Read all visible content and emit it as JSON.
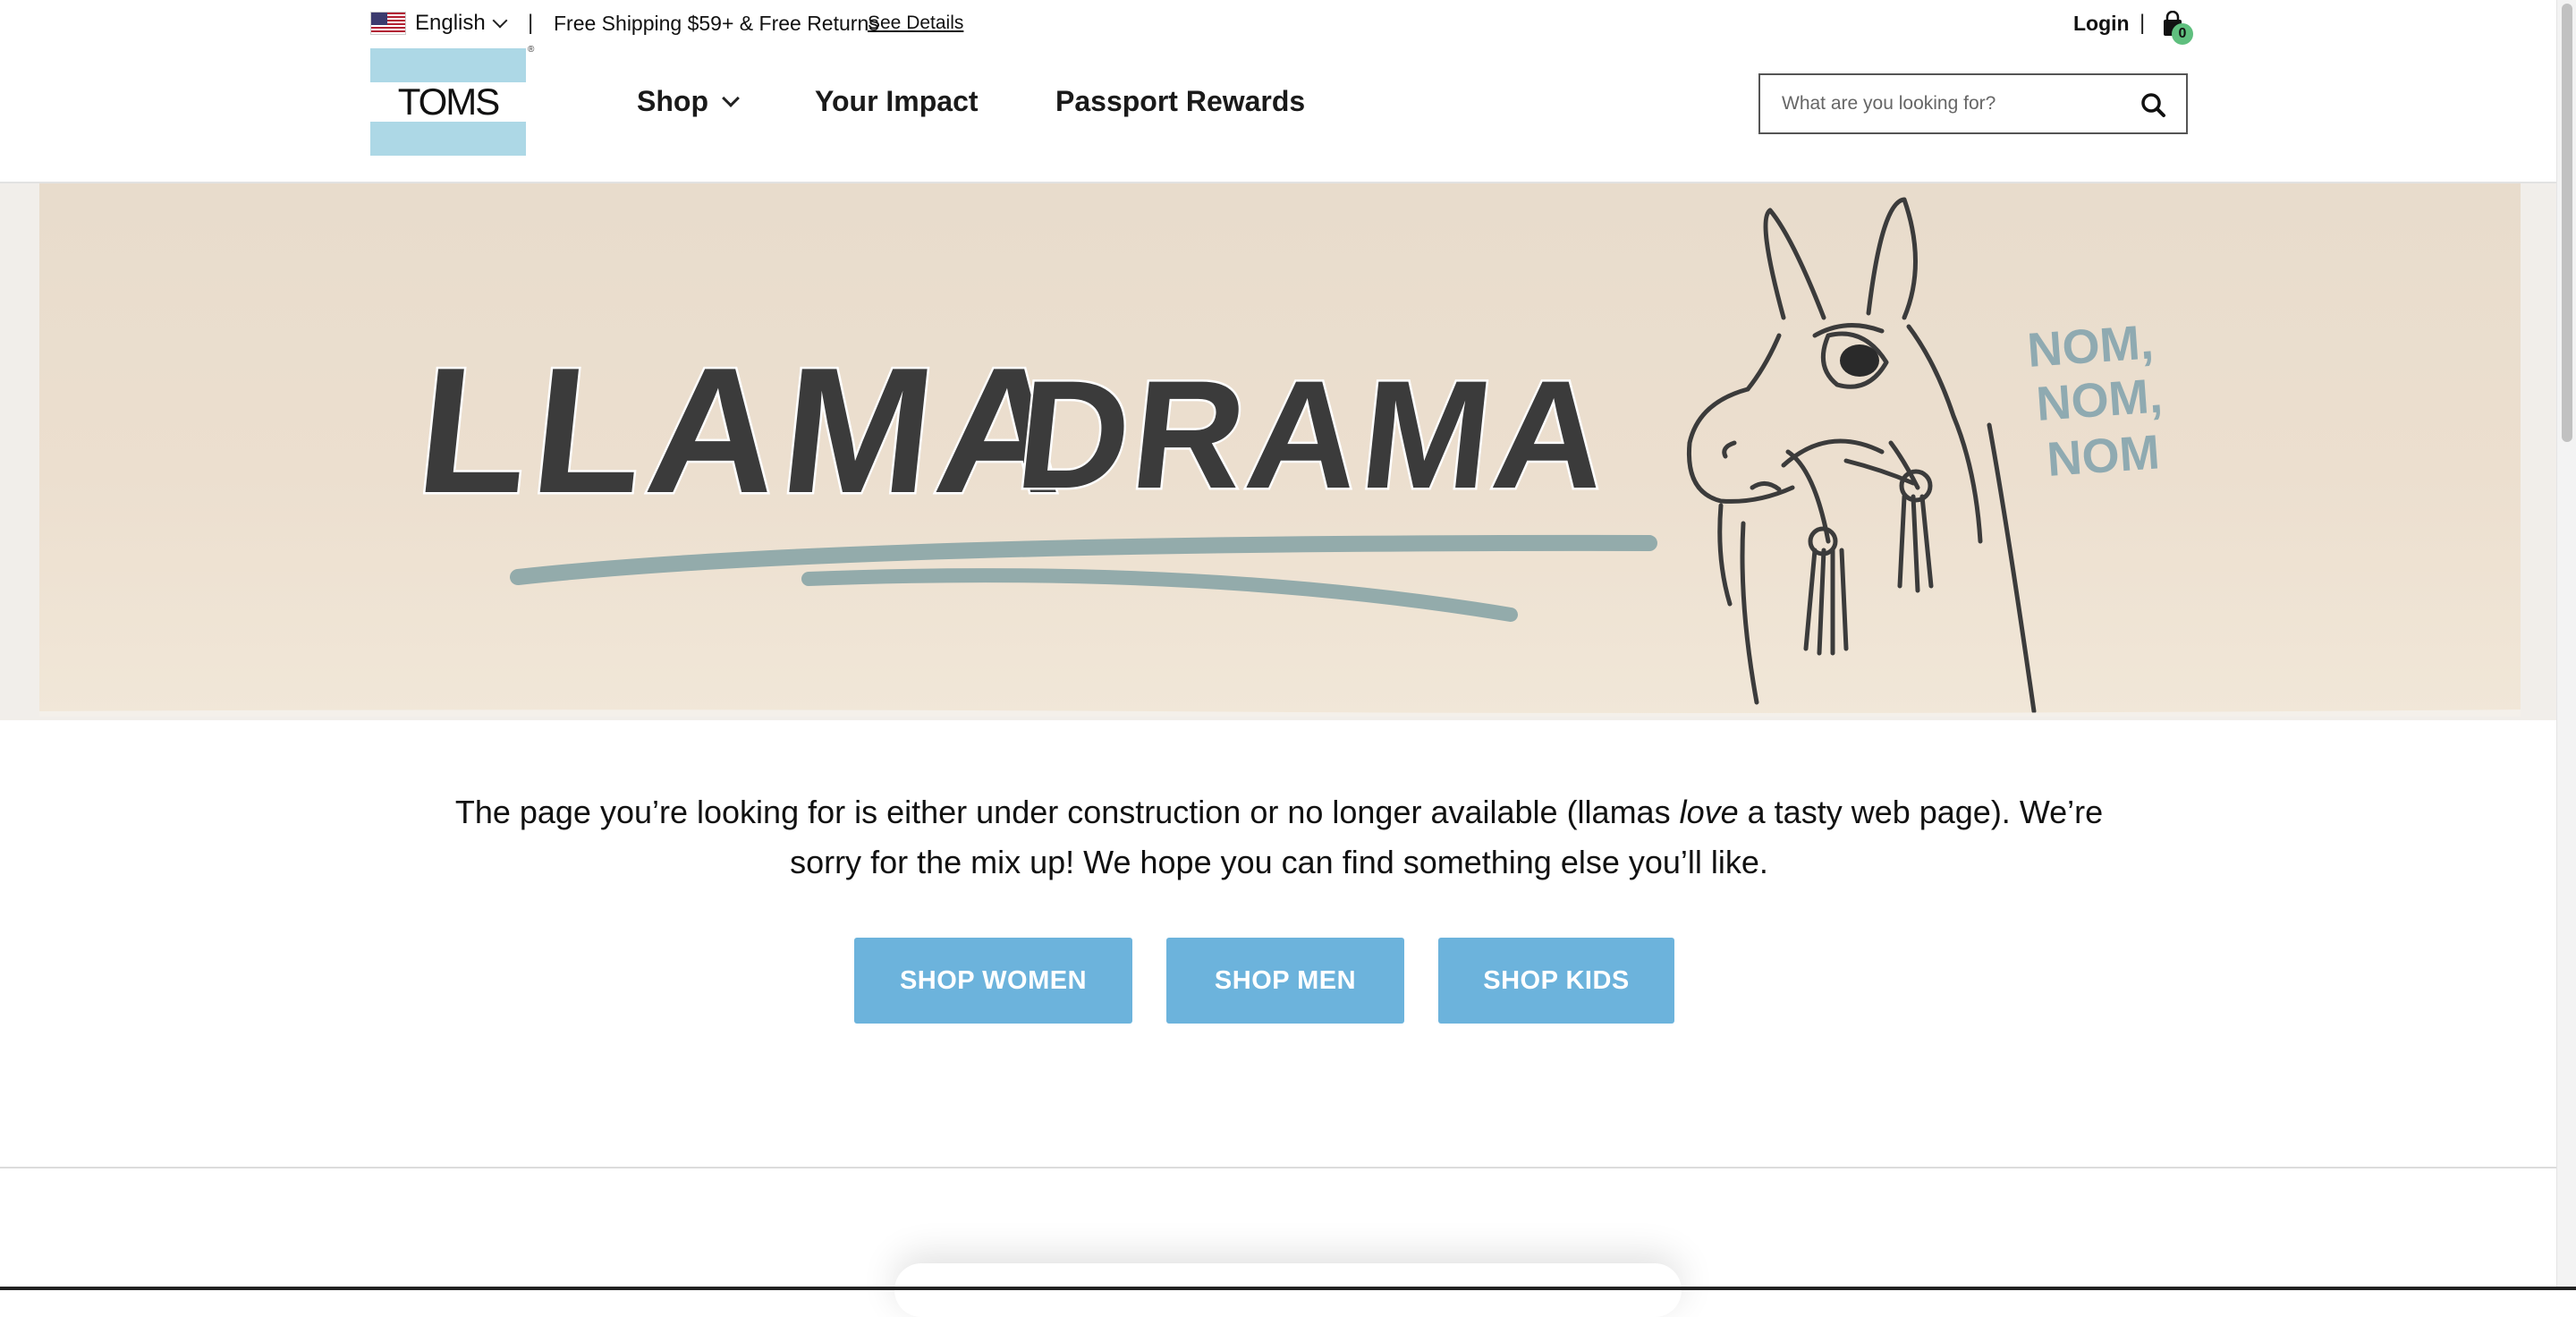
{
  "topbar": {
    "language": "English",
    "separator": "|",
    "promo": "Free Shipping $59+ & Free Returns",
    "see_details": "See Details",
    "login": "Login",
    "cart_count": "0"
  },
  "header": {
    "logo": "TOMS",
    "nav": [
      "Shop",
      "Your Impact",
      "Passport Rewards"
    ],
    "search_placeholder": "What are you looking for?"
  },
  "hero": {
    "title_left": "LLAMA",
    "title_right": "DRAMA",
    "side_text": [
      "NOM,",
      "NOM,",
      "NOM"
    ]
  },
  "message": {
    "part1": "The page you’re looking for is either under construction or no longer available (llamas ",
    "emphasis": "love",
    "part2": " a tasty web page). We’re sorry for the mix up! We hope you can find something else you’ll like."
  },
  "buttons": [
    "SHOP WOMEN",
    "SHOP MEN",
    "SHOP KIDS"
  ],
  "colors": {
    "button_blue": "#6cb3dc",
    "logo_blue": "#add8e6",
    "cart_badge": "#5fbf7e",
    "hero_bg": "#ecdfcf"
  }
}
